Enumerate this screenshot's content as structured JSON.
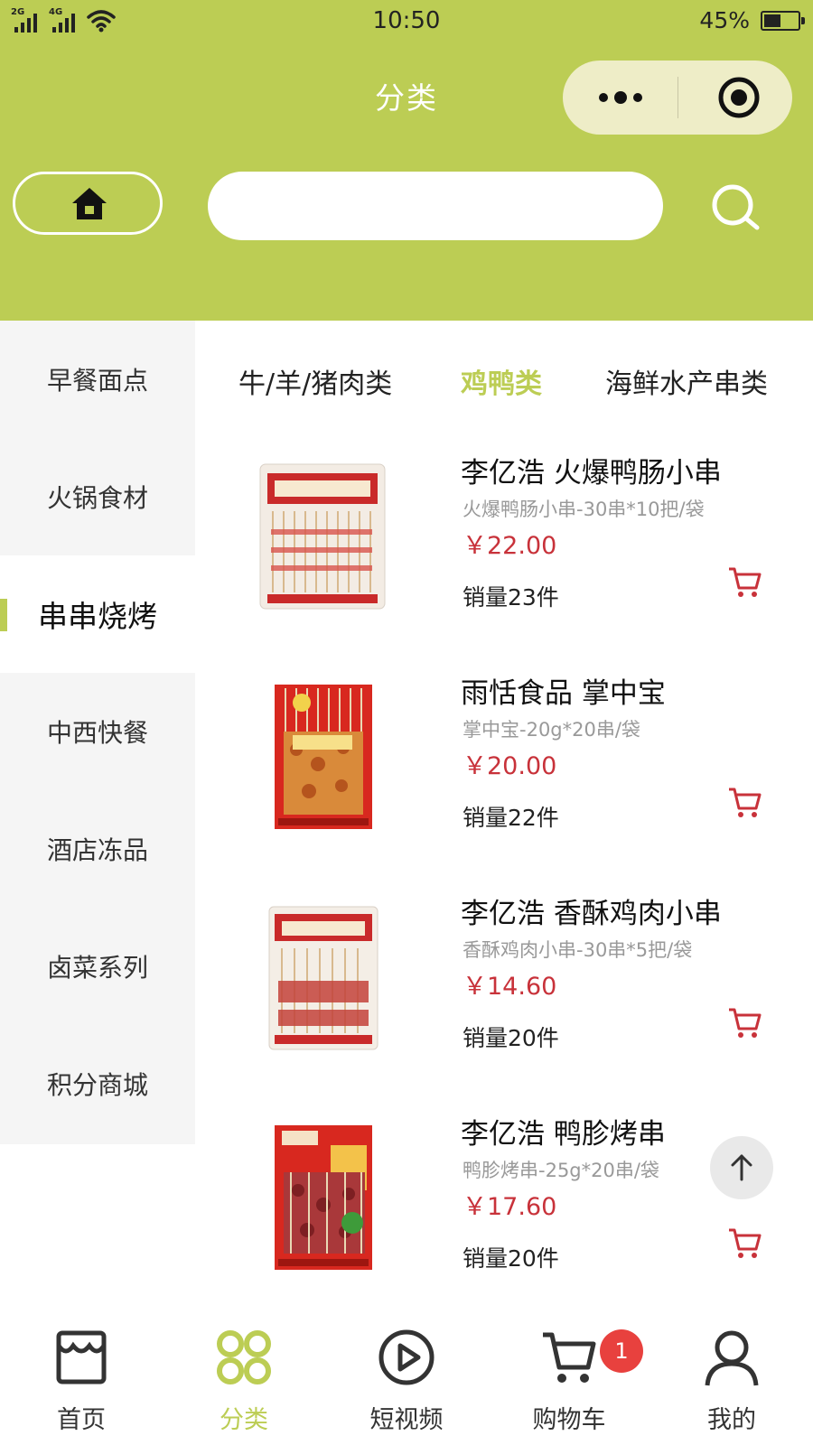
{
  "status_bar": {
    "network_a": "2G",
    "network_b": "4G",
    "time": "10:50",
    "battery": "45%",
    "battery_level": 0.45
  },
  "nav": {
    "title": "分类",
    "capsule_icons": [
      "more-icon",
      "target-icon"
    ]
  },
  "search": {
    "home_icon": "home-icon",
    "placeholder": "",
    "search_icon": "search-icon"
  },
  "sidebar": {
    "active_index": 2,
    "items": [
      {
        "label": "早餐面点"
      },
      {
        "label": "火锅食材"
      },
      {
        "label": "串串烧烤"
      },
      {
        "label": "中西快餐"
      },
      {
        "label": "酒店冻品"
      },
      {
        "label": "卤菜系列"
      },
      {
        "label": "积分商城"
      }
    ]
  },
  "subtabs": {
    "active_index": 1,
    "items": [
      {
        "label": "牛/羊/猪肉类"
      },
      {
        "label": "鸡鸭类"
      },
      {
        "label": "海鲜水产串类"
      }
    ]
  },
  "products": [
    {
      "name": "李亿浩 火爆鸭肠小串",
      "spec": "火爆鸭肠小串-30串*10把/袋",
      "price": "￥22.00",
      "sales": "销量23件"
    },
    {
      "name": "雨恬食品 掌中宝",
      "spec": "掌中宝-20g*20串/袋",
      "price": "￥20.00",
      "sales": "销量22件"
    },
    {
      "name": "李亿浩 香酥鸡肉小串",
      "spec": "香酥鸡肉小串-30串*5把/袋",
      "price": "￥14.60",
      "sales": "销量20件"
    },
    {
      "name": "李亿浩 鸭胗烤串",
      "spec": "鸭胗烤串-25g*20串/袋",
      "price": "￥17.60",
      "sales": "销量20件"
    }
  ],
  "tabbar": {
    "active_index": 1,
    "items": [
      {
        "label": "首页",
        "icon": "shop-icon"
      },
      {
        "label": "分类",
        "icon": "grid-icon"
      },
      {
        "label": "短视频",
        "icon": "play-icon"
      },
      {
        "label": "购物车",
        "icon": "cart-icon",
        "badge": "1"
      },
      {
        "label": "我的",
        "icon": "user-icon"
      }
    ]
  },
  "colors": {
    "brand": "#bccd54",
    "price": "#c8323a",
    "badge": "#e8413e"
  }
}
